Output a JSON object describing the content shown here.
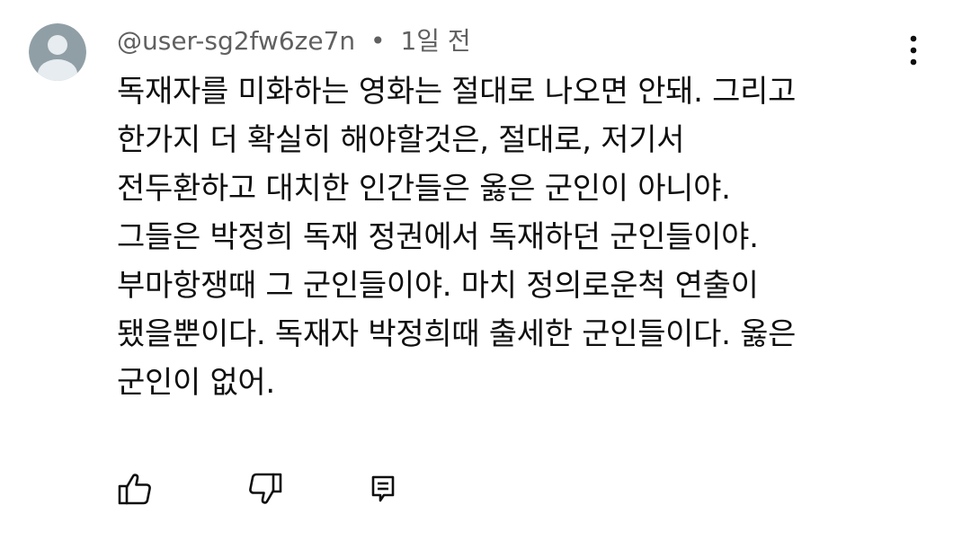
{
  "comment": {
    "author": "@user-sg2fw6ze7n",
    "separator": "•",
    "timestamp": "1일 전",
    "lines": [
      "독재자를 미화하는 영화는 절대로 나오면 안돼. 그리고",
      "한가지 더 확실히 해야할것은, 절대로, 저기서",
      "전두환하고 대치한 인간들은 옳은 군인이 아니야.",
      "그들은 박정희 독재 정권에서 독재하던 군인들이야.",
      "부마항쟁때 그 군인들이야. 마치 정의로운척 연출이",
      "됐을뿐이다. 독재자 박정희때 출세한 군인들이다. 옳은",
      "군인이 없어."
    ]
  },
  "icons": {
    "avatar": "default-avatar-icon",
    "more": "more-vertical-icon",
    "like": "thumbs-up-icon",
    "dislike": "thumbs-down-icon",
    "reply": "reply-icon"
  },
  "colors": {
    "text": "#0f0f0f",
    "meta": "#606060",
    "avatar_bg": "#909fa6",
    "avatar_fg": "#e6ecef"
  }
}
